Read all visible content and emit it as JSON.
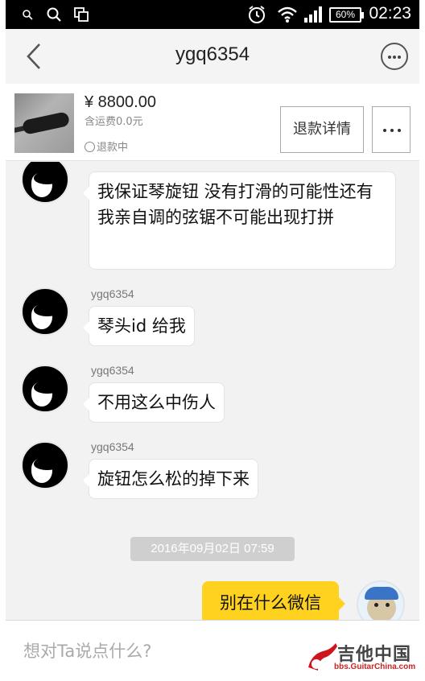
{
  "status_bar": {
    "time": "02:23",
    "battery": "60%",
    "icons": [
      "search-icon",
      "search-icon",
      "copy-icon",
      "alarm-icon",
      "wifi-icon",
      "signal-icon",
      "battery-icon"
    ]
  },
  "header": {
    "title": "ygq6354",
    "back_icon": "chevron-left-icon",
    "more_icon": "ellipsis-circle-icon"
  },
  "product": {
    "price": "¥ 8800.00",
    "shipping": "含运费0.0元",
    "status": "退款中",
    "refund_button": "退款详情"
  },
  "messages": [
    {
      "sender": "",
      "text": "我保证琴旋钮 没有打滑的可能性还有我亲自调的弦锯不可能出现打拼"
    },
    {
      "sender": "ygq6354",
      "text": "琴头id 给我"
    },
    {
      "sender": "ygq6354",
      "text": "不用这么中伤人"
    },
    {
      "sender": "ygq6354",
      "text": "旋钮怎么松的掉下来"
    }
  ],
  "timestamp": "2016年09月02日 07:59",
  "self_message": {
    "text": "别在什么微信"
  },
  "input": {
    "placeholder": "想对Ta说点什么?"
  },
  "watermark": {
    "title": "吉他中国",
    "subtitle": "bbs.GuitarChina.com"
  },
  "colors": {
    "self_bubble": "#ffd21f",
    "header_bg": "#f4f4f4",
    "chat_bg": "#f2f2f2"
  }
}
